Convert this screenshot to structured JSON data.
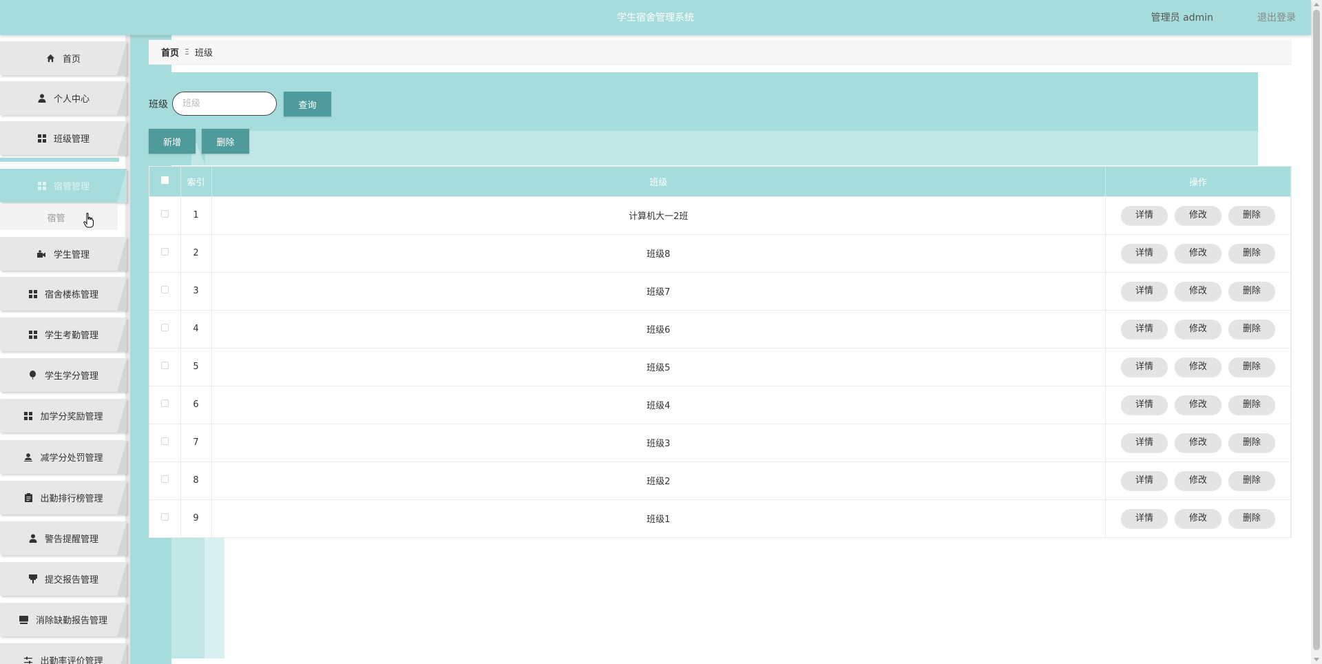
{
  "header": {
    "title": "学生宿舍管理系统",
    "user_label": "管理员 admin",
    "logout_label": "退出登录"
  },
  "sidebar": {
    "items": [
      {
        "label": "首页",
        "icon": "home-icon"
      },
      {
        "label": "个人中心",
        "icon": "person-icon"
      },
      {
        "label": "班级管理",
        "icon": "grid-icon"
      },
      {
        "label": "宿管管理",
        "icon": "grid-icon",
        "active": true
      },
      {
        "label": "学生管理",
        "icon": "video-icon"
      },
      {
        "label": "宿舍楼栋管理",
        "icon": "grid-icon"
      },
      {
        "label": "学生考勤管理",
        "icon": "grid-icon"
      },
      {
        "label": "学生学分管理",
        "icon": "balloon-icon"
      },
      {
        "label": "加学分奖励管理",
        "icon": "grid-icon"
      },
      {
        "label": "减学分处罚管理",
        "icon": "user-minus-icon"
      },
      {
        "label": "出勤排行榜管理",
        "icon": "clipboard-icon"
      },
      {
        "label": "警告提醒管理",
        "icon": "user-icon"
      },
      {
        "label": "提交报告管理",
        "icon": "flag-icon"
      },
      {
        "label": "消除缺勤报告管理",
        "icon": "monitor-icon"
      },
      {
        "label": "出勤率评价管理",
        "icon": "sliders-icon"
      }
    ],
    "submenu": {
      "label": "宿管"
    }
  },
  "breadcrumb": {
    "home": "首页",
    "separator": "Ξ",
    "current": "班级"
  },
  "search": {
    "label": "班级",
    "placeholder": "班级",
    "query_button": "查询",
    "add_button": "新增",
    "delete_button": "删除"
  },
  "table": {
    "columns": {
      "index": "索引",
      "class": "班级",
      "ops": "操作"
    },
    "actions": {
      "detail": "详情",
      "edit": "修改",
      "delete": "删除"
    },
    "rows": [
      {
        "index": "1",
        "class": "计算机大一2班"
      },
      {
        "index": "2",
        "class": "班级8"
      },
      {
        "index": "3",
        "class": "班级7"
      },
      {
        "index": "4",
        "class": "班级6"
      },
      {
        "index": "5",
        "class": "班级5"
      },
      {
        "index": "6",
        "class": "班级4"
      },
      {
        "index": "7",
        "class": "班级3"
      },
      {
        "index": "8",
        "class": "班级2"
      },
      {
        "index": "9",
        "class": "班级1"
      }
    ]
  },
  "colors": {
    "primary": "#a6dcdc",
    "button_dark": "#4f9a9a",
    "sidebar_bg": "#e7e7e7"
  }
}
